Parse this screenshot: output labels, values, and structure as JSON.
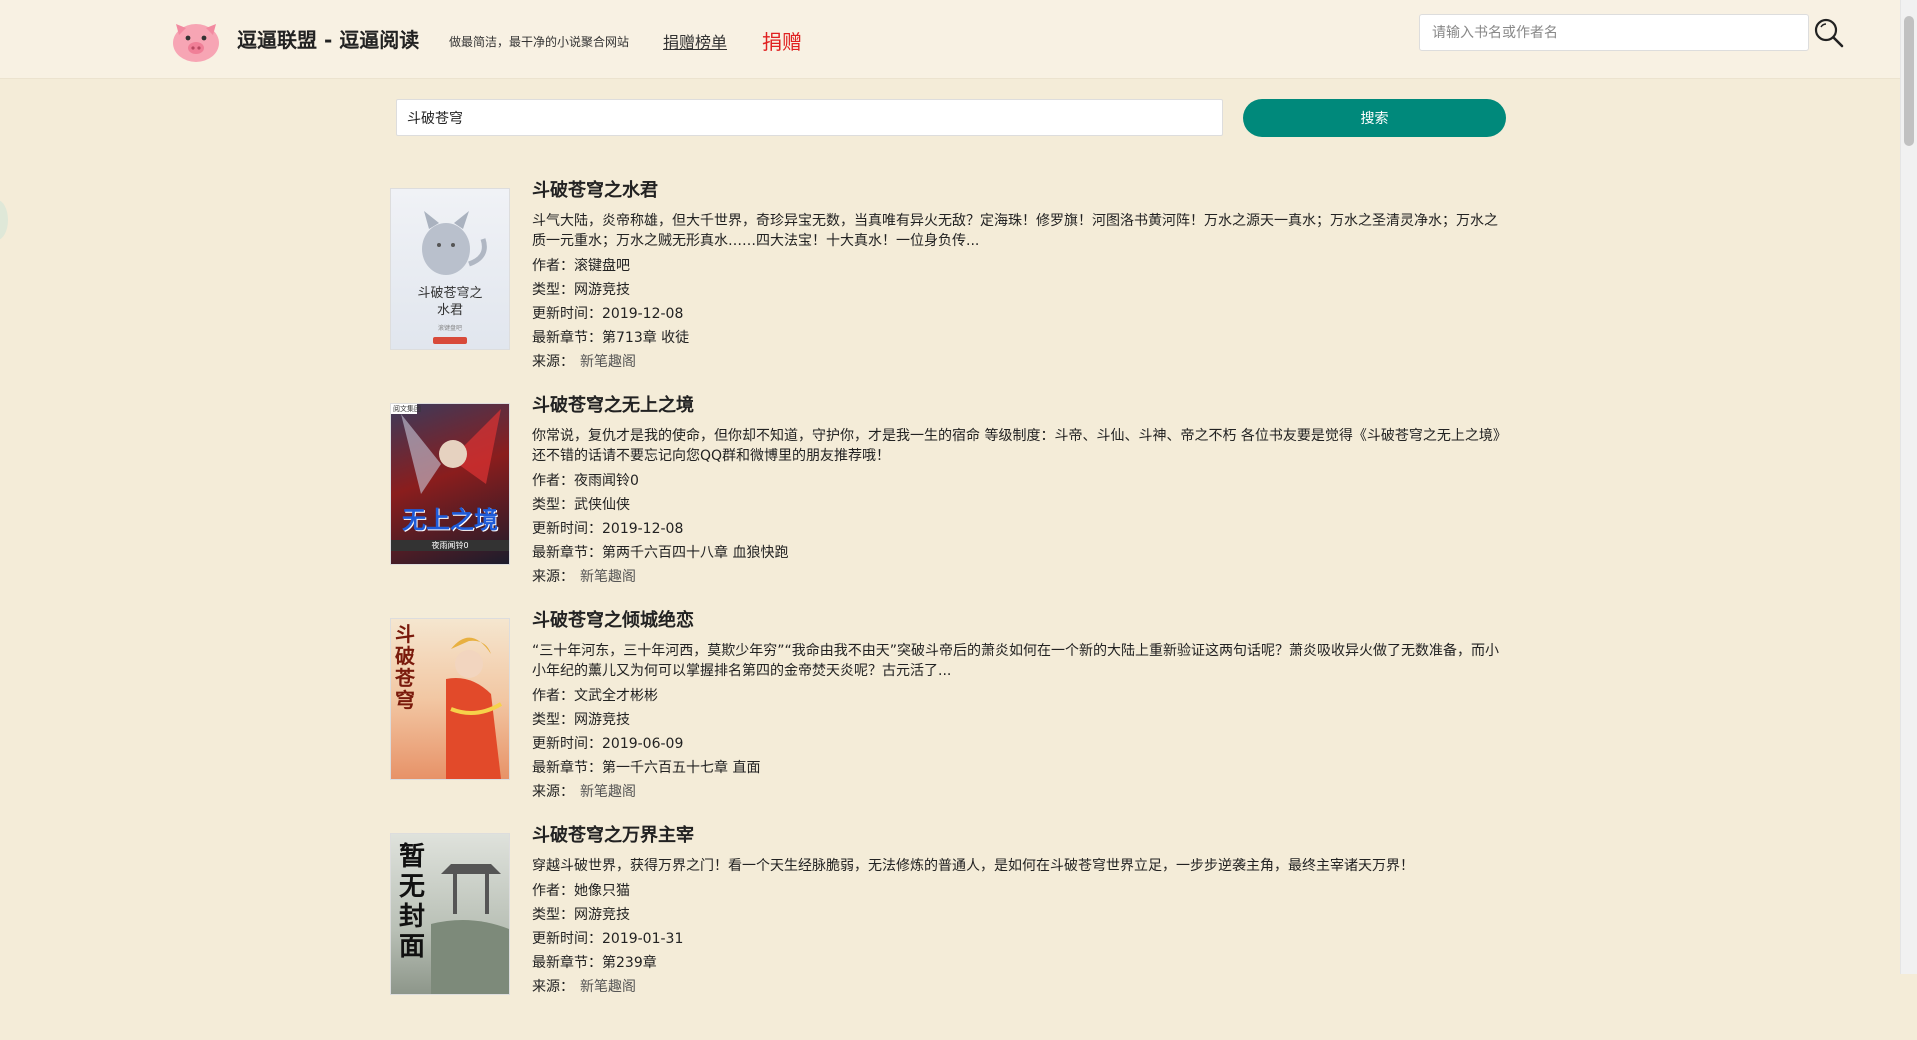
{
  "header": {
    "site_title": "逗逼联盟 - 逗逼阅读",
    "slogan": "做最简洁，最干净的小说聚合网站",
    "nav_rank": "捐赠榜单",
    "nav_donate": "捐赠",
    "search_placeholder": "请输入书名或作者名"
  },
  "search": {
    "query": "斗破苍穹",
    "button": "搜索"
  },
  "labels": {
    "author": "作者：",
    "type": "类型：",
    "updated": "更新时间：",
    "latest": "最新章节：",
    "source": "来源："
  },
  "books": [
    {
      "title": "斗破苍穹之水君",
      "desc": "斗气大陆，炎帝称雄，但大千世界，奇珍异宝无数，当真唯有异火无敌？定海珠！修罗旗！河图洛书黄河阵！万水之源天一真水；万水之圣清灵净水；万水之质一元重水；万水之贼无形真水……四大法宝！十大真水！一位身负传...",
      "author": "滚键盘吧",
      "type": "网游竞技",
      "updated": "2019-12-08",
      "latest": "第713章 收徒",
      "source": "新笔趣阁",
      "cover_text": "斗破苍穹之水君",
      "cover_sub": "滚键盘吧"
    },
    {
      "title": "斗破苍穹之无上之境",
      "desc": "你常说，复仇才是我的使命，但你却不知道，守护你，才是我一生的宿命 等级制度：斗帝、斗仙、斗神、帝之不朽 各位书友要是觉得《斗破苍穹之无上之境》还不错的话请不要忘记向您QQ群和微博里的朋友推荐哦！",
      "author": "夜雨闻铃0",
      "type": "武侠仙侠",
      "updated": "2019-12-08",
      "latest": "第两千六百四十八章 血狼快跑",
      "source": "新笔趣阁",
      "cover_text": "无上之境",
      "cover_sub": "夜雨闻铃0"
    },
    {
      "title": "斗破苍穹之倾城绝恋",
      "desc": "“三十年河东，三十年河西，莫欺少年穷”“我命由我不由天”突破斗帝后的萧炎如何在一个新的大陆上重新验证这两句话呢？萧炎吸收异火做了无数准备，而小小年纪的薰儿又为何可以掌握排名第四的金帝焚天炎呢？古元活了...",
      "author": "文武全才彬彬",
      "type": "网游竞技",
      "updated": "2019-06-09",
      "latest": "第一千六百五十七章 直面",
      "source": "新笔趣阁",
      "cover_text": "斗破苍穹",
      "cover_sub": ""
    },
    {
      "title": "斗破苍穹之万界主宰",
      "desc": "穿越斗破世界，获得万界之门！看一个天生经脉脆弱，无法修炼的普通人，是如何在斗破苍穹世界立足，一步步逆袭主角，最终主宰诸天万界！",
      "author": "她像只猫",
      "type": "网游竞技",
      "updated": "2019-01-31",
      "latest": "第239章",
      "source": "新笔趣阁",
      "cover_text": "暂无封面",
      "cover_sub": ""
    }
  ],
  "colors": {
    "background": "#f4ecd8",
    "header_bg": "#f8f1e3",
    "accent": "#00897b",
    "donate": "#e02020"
  }
}
